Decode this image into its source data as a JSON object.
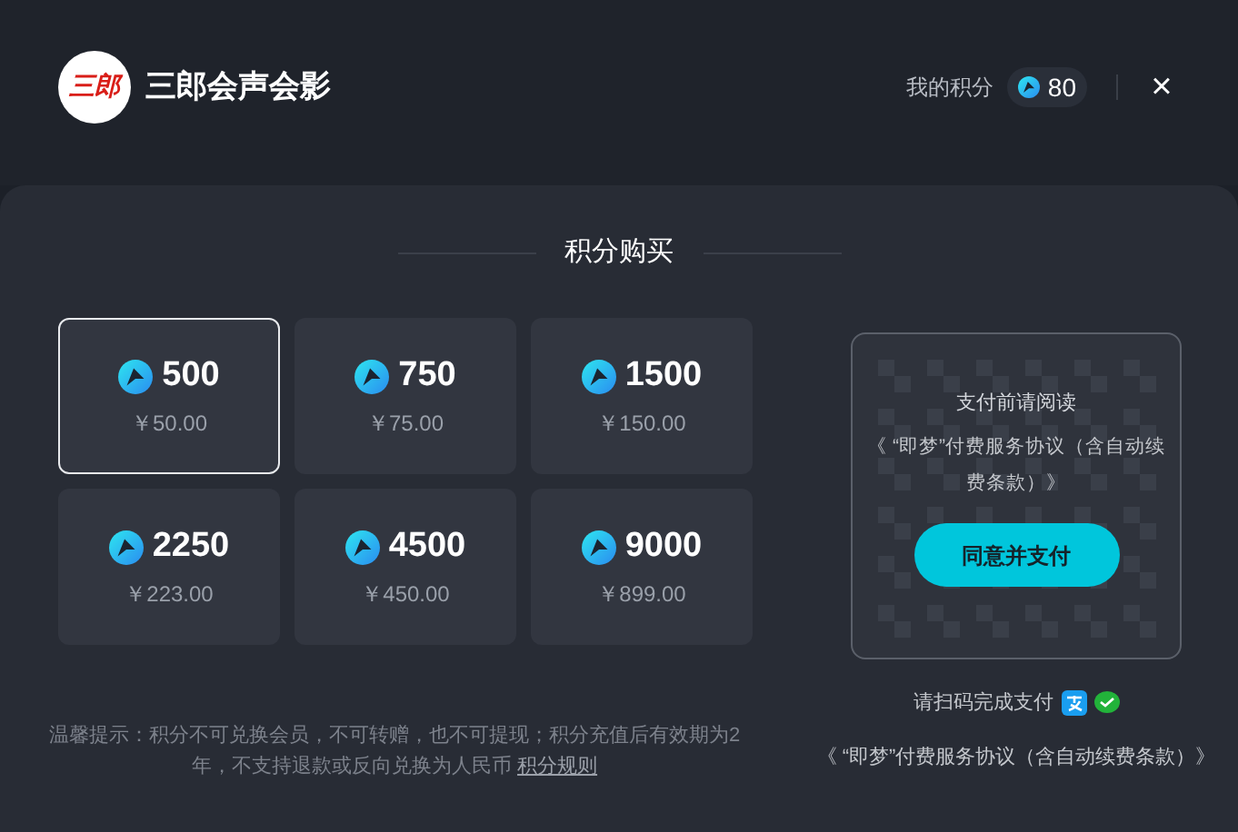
{
  "header": {
    "logo_text": "三郎",
    "title": "三郎会声会影",
    "points_label": "我的积分",
    "points_value": "80",
    "close": "×"
  },
  "section_title": "积分购买",
  "packages": [
    {
      "points": "500",
      "price": "￥50.00",
      "selected": true
    },
    {
      "points": "750",
      "price": "￥75.00",
      "selected": false
    },
    {
      "points": "1500",
      "price": "￥150.00",
      "selected": false
    },
    {
      "points": "2250",
      "price": "￥223.00",
      "selected": false
    },
    {
      "points": "4500",
      "price": "￥450.00",
      "selected": false
    },
    {
      "points": "9000",
      "price": "￥899.00",
      "selected": false
    }
  ],
  "notice": {
    "text": "温馨提示：积分不可兑换会员，不可转赠，也不可提现；积分充值后有效期为2年，不支持退款或反向兑换为人民币",
    "link": "积分规则"
  },
  "payment": {
    "read_first": "支付前请阅读",
    "agreement": "《 “即梦”付费服务协议（含自动续费条款）》",
    "pay_button": "同意并支付",
    "scan_hint": "请扫码完成支付",
    "footer_agreement": "《 “即梦”付费服务协议（含自动续费条款）》"
  }
}
